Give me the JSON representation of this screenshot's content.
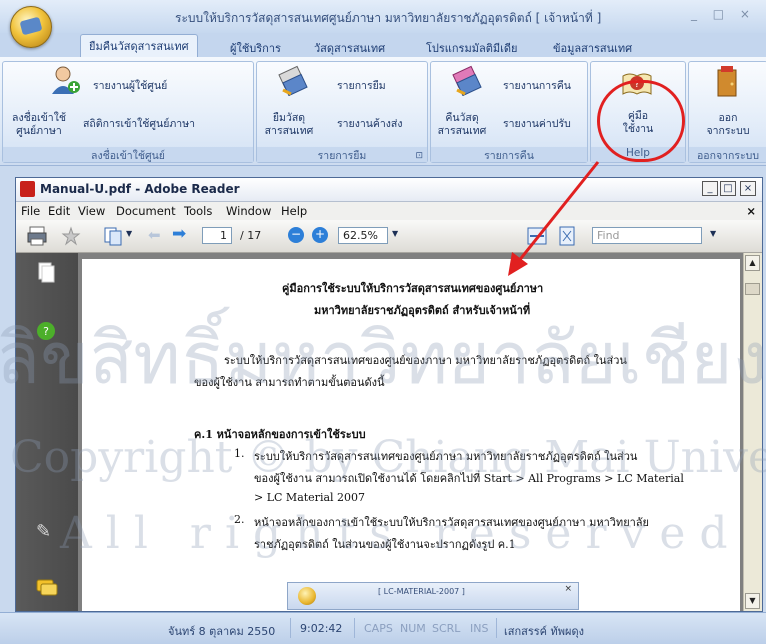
{
  "app": {
    "title": "ระบบให้บริการวัสดุสารสนเทศศูนย์ภาษา มหาวิทยาลัยราชภัฏอุตรดิตถ์ [ เจ้าหน้าที่ ]",
    "window_controls": "_ □ ×"
  },
  "ribbon_tabs": [
    {
      "label": "ยืมคืนวัสดุสารสนเทศ",
      "active": true
    },
    {
      "label": "ผู้ใช้บริการ"
    },
    {
      "label": "วัสดุสารสนเทศ"
    },
    {
      "label": "โปรแกรมมัลติมีเดีย"
    },
    {
      "label": "ข้อมูลสารสนเทศ"
    }
  ],
  "ribbon": {
    "group1": {
      "label": "ลงชื่อเข้าใช้ศูนย์",
      "checkin_line1": "ลงชื่อเข้าใช้",
      "checkin_line2": "ศูนย์ภาษา",
      "user_report": "รายงานผู้ใช้ศูนย์",
      "stats": "สถิติการเข้าใช้ศูนย์ภาษา"
    },
    "group2": {
      "label": "รายการยืม",
      "borrow_line1": "ยืมวัสดุ",
      "borrow_line2": "สารสนเทศ",
      "borrow_list": "รายการยืม",
      "overdue_report": "รายงานค้างส่ง"
    },
    "group3": {
      "label": "รายการคืน",
      "return_line1": "คืนวัสดุ",
      "return_line2": "สารสนเทศ",
      "return_report": "รายงานการคืน",
      "fine_report": "รายงานค่าปรับ"
    },
    "group4": {
      "label": "Help",
      "manual_line1": "คู่มือ",
      "manual_line2": "ใช้งาน"
    },
    "group5": {
      "label": "ออกจากระบบ",
      "exit_line1": "ออก",
      "exit_line2": "จากระบบ"
    }
  },
  "reader": {
    "title": "Manual-U.pdf - Adobe Reader",
    "menus": [
      "File",
      "Edit",
      "View",
      "Document",
      "Tools",
      "Window",
      "Help"
    ],
    "page_current": "1",
    "page_total": "/ 17",
    "zoom": "62.5%",
    "find_placeholder": "Find",
    "close_doc": "×"
  },
  "document": {
    "title_line1": "คู่มือการใช้ระบบให้บริการวัสดุสารสนเทศของศูนย์ภาษา",
    "title_line2": "มหาวิทยาลัยราชภัฏอุตรดิตถ์ สำหรับเจ้าหน้าที่",
    "intro_line1": "ระบบให้บริการวัสดุสารสนเทศของศูนย์ของภาษา มหาวิทยาลัยราชภัฏอุตรดิตถ์ ในส่วน",
    "intro_line2": "ของผู้ใช้งาน สามารถทำตามขั้นตอนดังนี้",
    "section_heading": "ค.1 หน้าจอหลักของการเข้าใช้ระบบ",
    "item1_num": "1.",
    "item1_line1": "ระบบให้บริการวัสดุสารสนเทศของศูนย์ภาษา มหาวิทยาลัยราชภัฏอุตรดิตถ์ ในส่วน",
    "item1_line2": "ของผู้ใช้งาน สามารถเปิดใช้งานได้ โดยคลิกไปที่ Start > All Programs > LC Material",
    "item1_line3": "> LC Material 2007",
    "item2_num": "2.",
    "item2_line1": "หน้าจอหลักของการเข้าใช้ระบบให้บริการวัสดุสารสนเทศของศูนย์ภาษา มหาวิทยาลัย",
    "item2_line2": "ราชภัฏอุตรดิตถ์ ในส่วนของผู้ใช้งานจะปรากฏดังรูป ค.1",
    "figure_title": "[ LC-MATERIAL-2007 ]",
    "figure_close": "×"
  },
  "status": {
    "date": "จันทร์ 8 ตุลาคม 2550",
    "time": "9:02:42",
    "caps": "CAPS",
    "num": "NUM",
    "scrl": "SCRL",
    "ins": "INS",
    "user": "เสกสรรค์ ทัพผดุง"
  },
  "watermark": {
    "line1": "ลิขสิทธิ์มหาวิทยาลัยเชียงใหม่",
    "line2": "Copyright © by Chiang Mai University",
    "line3": "All rights reserved"
  },
  "colors": {
    "highlight_red": "#e12020",
    "ribbon_bg": "#dbe7f6",
    "reader_chrome": "#d4d0c8"
  }
}
